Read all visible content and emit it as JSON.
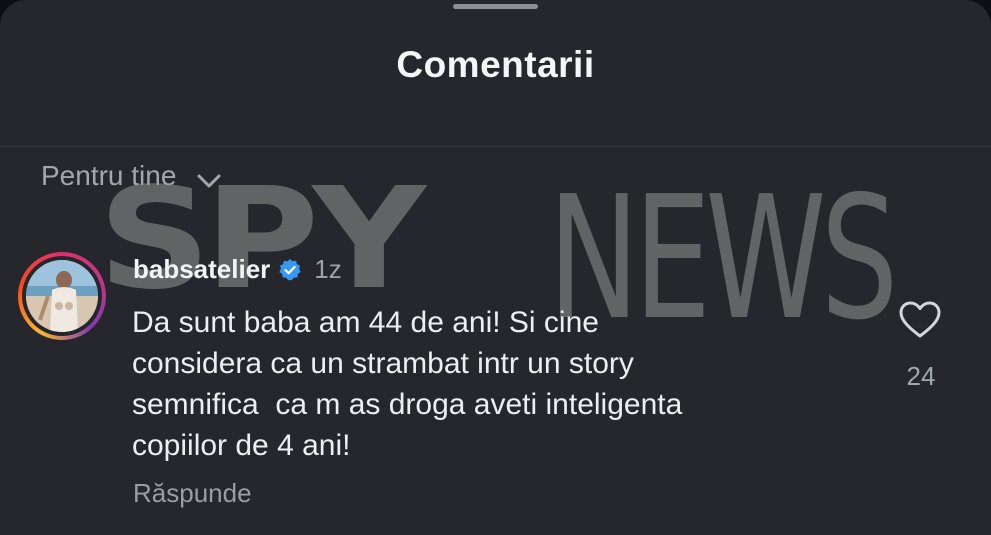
{
  "header": {
    "title": "Comentarii"
  },
  "filter": {
    "label": "Pentru tine"
  },
  "comment": {
    "username": "babsatelier",
    "time": "1z",
    "text_lines": [
      "Da sunt baba am 44 de ani! Si cine",
      "considera ca un strambat intr un story",
      "semnifica  ca m as droga aveti inteligenta",
      "copiilor de 4 ani!"
    ],
    "reply_label": "Răspunde",
    "like_count": "24"
  },
  "watermark": {
    "part1": "SPY",
    "part2": "NEWS"
  },
  "colors": {
    "background": "#25272c",
    "verified": "#3897f0",
    "text": "#eceef0",
    "muted": "#9ea2a8"
  },
  "icons": {
    "filter": "chevron-down-icon",
    "verified": "verified-badge-icon",
    "like": "heart-outline-icon"
  }
}
